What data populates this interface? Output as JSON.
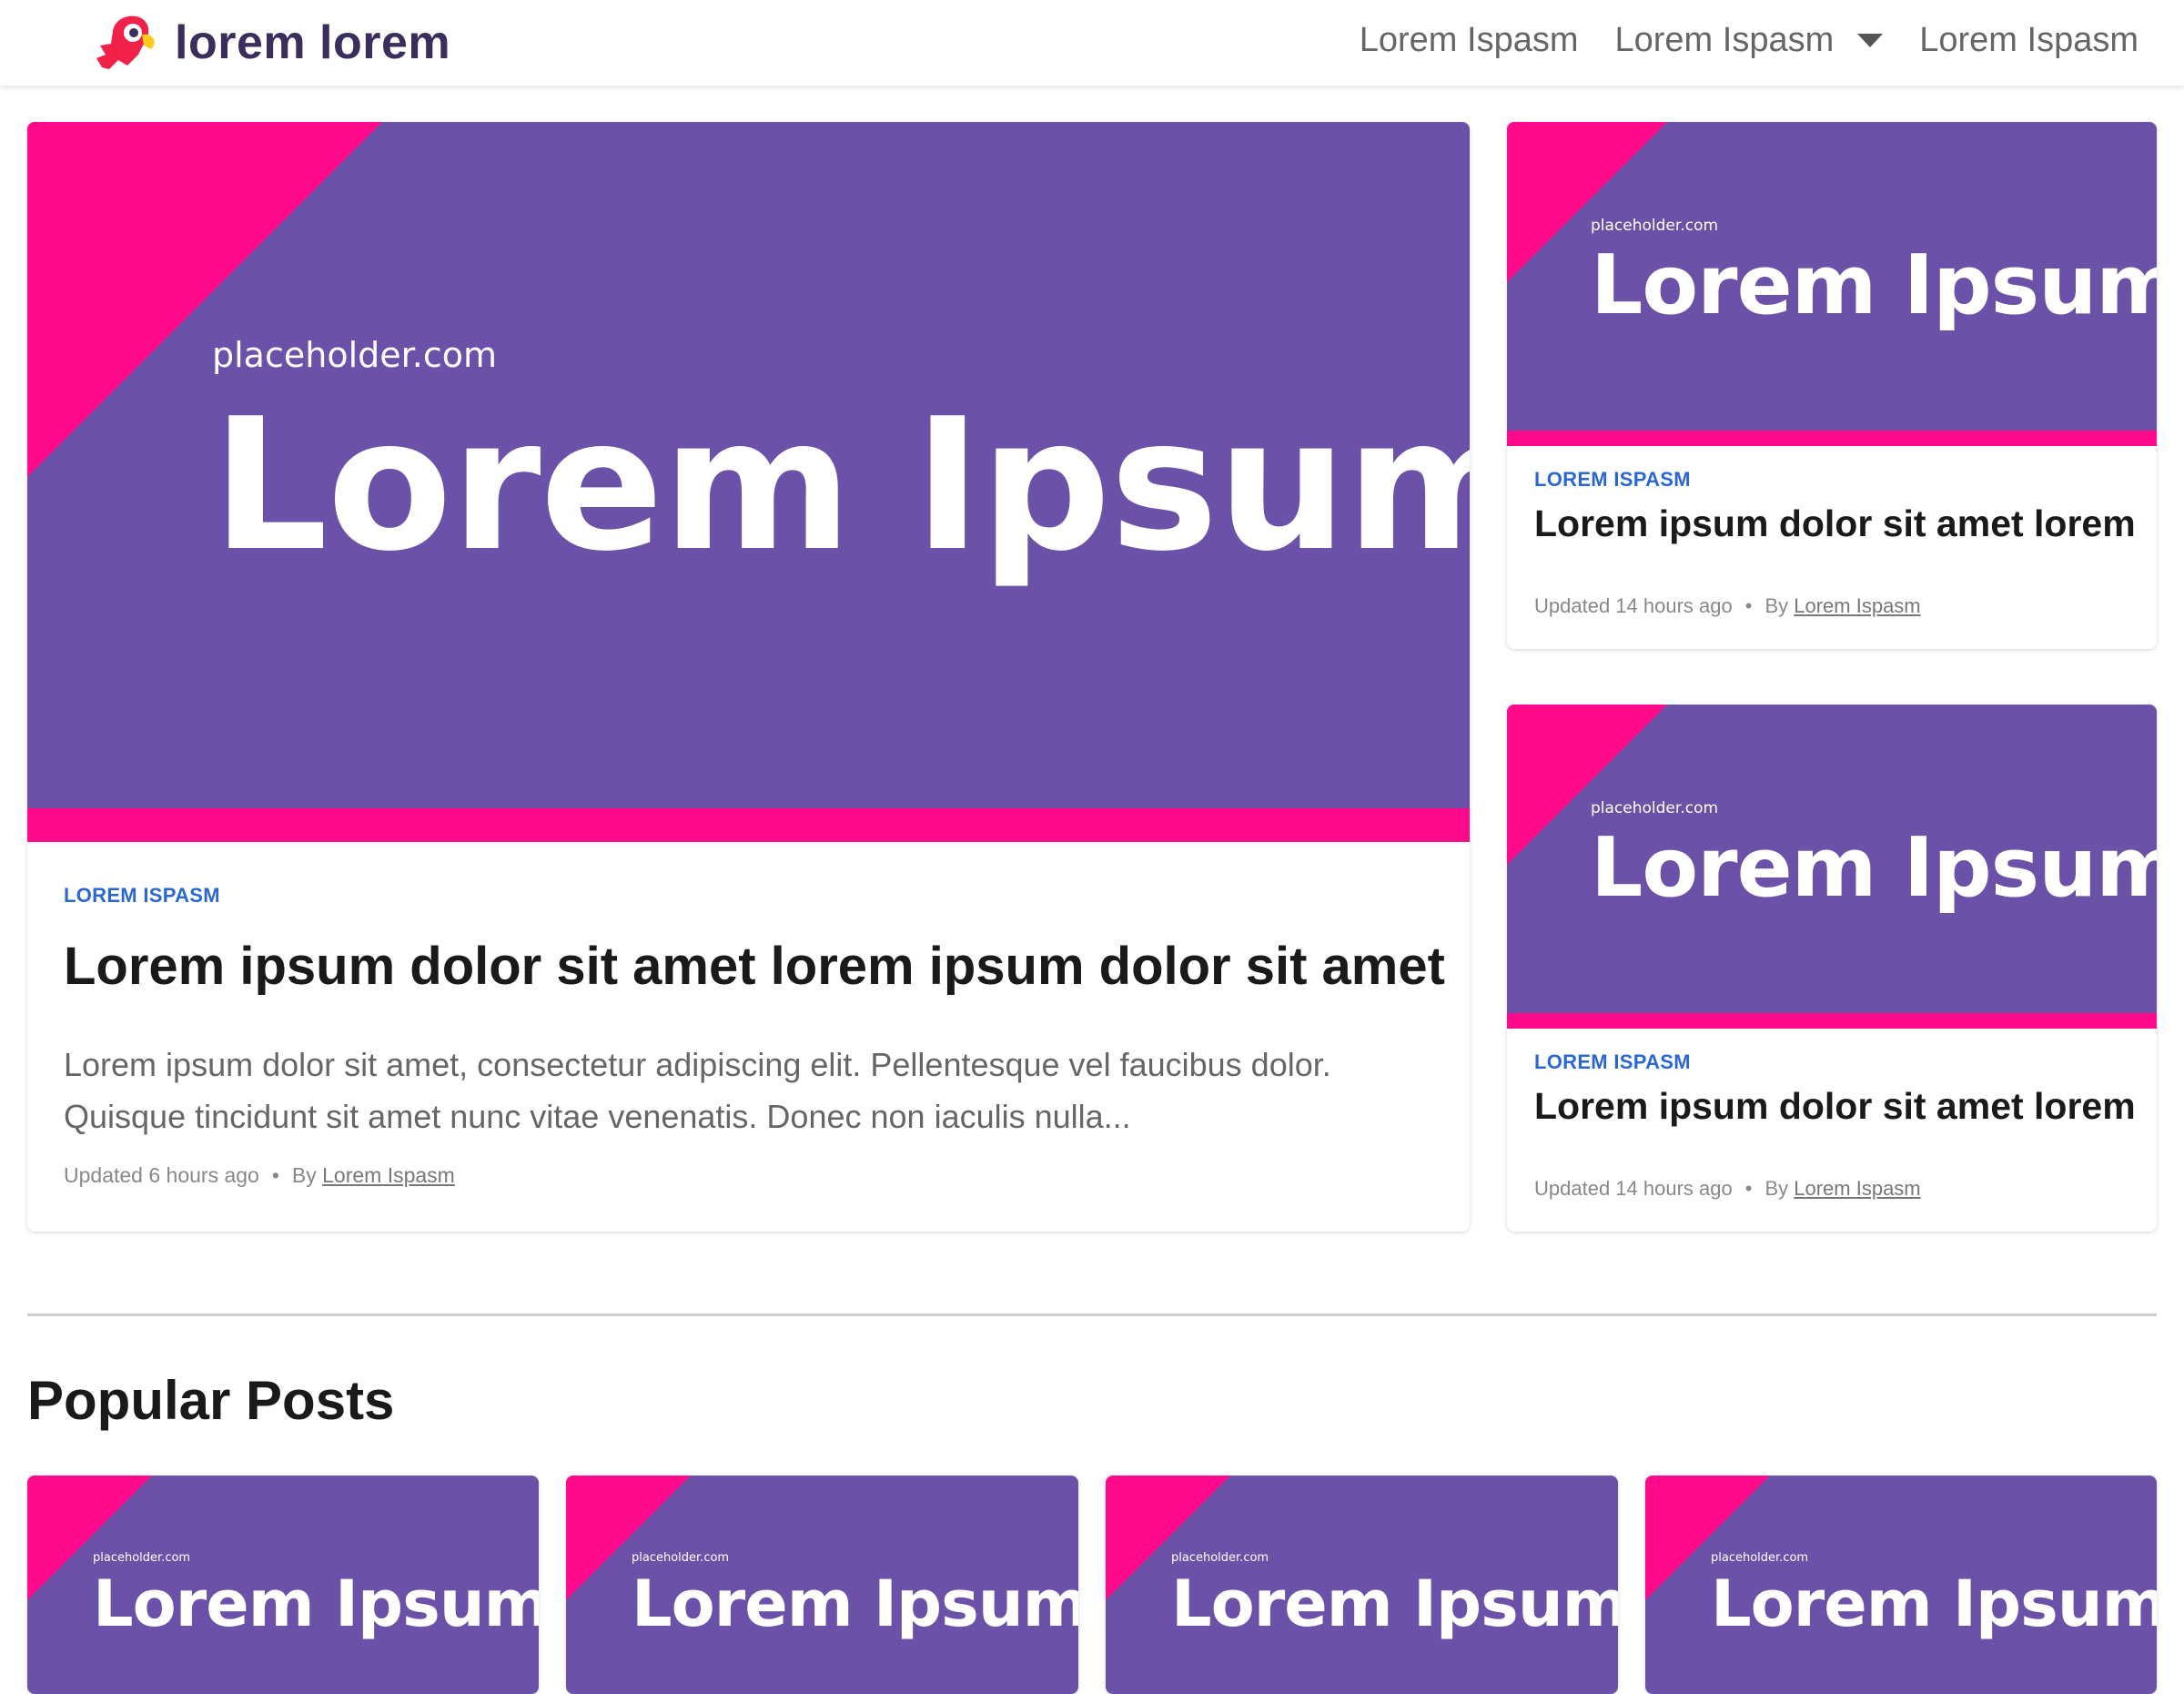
{
  "brand": {
    "name": "lorem lorem"
  },
  "nav": {
    "items": [
      "Lorem Ispasm",
      "Lorem Ispasm",
      "Lorem Ispasm"
    ]
  },
  "featured": {
    "thumb_site": "placeholder.com",
    "thumb_text": "Lorem Ipsum",
    "category": "LOREM ISPASM",
    "title": "Lorem ipsum dolor sit amet lorem ipsum dolor sit amet",
    "excerpt": "Lorem ipsum dolor sit amet, consectetur adipiscing elit. Pellentesque vel faucibus dolor. Quisque tincidunt sit amet nunc vitae venenatis. Donec non iaculis nulla...",
    "updated": "Updated 6 hours ago",
    "by": "By",
    "author": "Lorem Ispasm"
  },
  "side_posts": [
    {
      "thumb_site": "placeholder.com",
      "thumb_text": "Lorem Ipsum",
      "category": "LOREM ISPASM",
      "title": "Lorem ipsum dolor sit amet lorem",
      "updated": "Updated 14 hours ago",
      "by": "By",
      "author": "Lorem Ispasm"
    },
    {
      "thumb_site": "placeholder.com",
      "thumb_text": "Lorem Ipsum",
      "category": "LOREM ISPASM",
      "title": "Lorem ipsum dolor sit amet lorem",
      "updated": "Updated 14 hours ago",
      "by": "By",
      "author": "Lorem Ispasm"
    }
  ],
  "popular": {
    "heading": "Popular Posts",
    "cards": [
      {
        "thumb_site": "placeholder.com",
        "thumb_text": "Lorem Ipsum"
      },
      {
        "thumb_site": "placeholder.com",
        "thumb_text": "Lorem Ipsum"
      },
      {
        "thumb_site": "placeholder.com",
        "thumb_text": "Lorem Ipsum"
      },
      {
        "thumb_site": "placeholder.com",
        "thumb_text": "Lorem Ipsum"
      }
    ]
  },
  "colors": {
    "accent_pink": "#ff0a8a",
    "thumb_purple": "#6b51a8",
    "category_blue": "#2b67d1"
  },
  "icons": {
    "logo": "parrot-logo-icon",
    "dropdown": "caret-down-icon"
  }
}
